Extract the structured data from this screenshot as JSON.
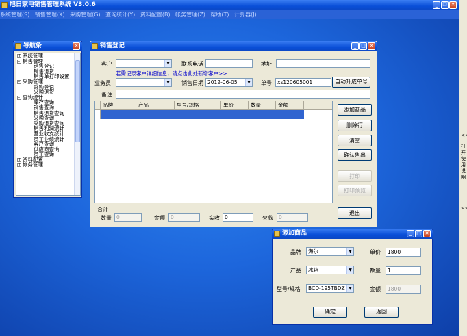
{
  "app": {
    "title": "旭日家电销售管理系统 V3.0.6",
    "menu": [
      "系统管理(S)",
      "销售管理(X)",
      "采购管理(G)",
      "查询统计(Y)",
      "资料配置(B)",
      "帐务管理(Z)",
      "帮助(T)",
      "计算器(J)"
    ],
    "sidebar_text": "打开使用说明",
    "sidebar_chevron": "<<"
  },
  "navigator": {
    "title": "导航条",
    "tree": [
      {
        "label": "系统管理",
        "level": 0,
        "expander": "+"
      },
      {
        "label": "销售管理",
        "level": 0,
        "expander": "-"
      },
      {
        "label": "销售登记",
        "level": 2
      },
      {
        "label": "销售退货",
        "level": 2
      },
      {
        "label": "销售单打印设置",
        "level": 2
      },
      {
        "label": "采购管理",
        "level": 0,
        "expander": "-"
      },
      {
        "label": "采购登记",
        "level": 2
      },
      {
        "label": "采购退货",
        "level": 2
      },
      {
        "label": "查询统计",
        "level": 0,
        "expander": "-"
      },
      {
        "label": "库存查询",
        "level": 2
      },
      {
        "label": "销售查询",
        "level": 2
      },
      {
        "label": "销售退货查询",
        "level": 2
      },
      {
        "label": "采购查询",
        "level": 2
      },
      {
        "label": "采购退货查询",
        "level": 2
      },
      {
        "label": "销售利润统计",
        "level": 2
      },
      {
        "label": "营业收支统计",
        "level": 2
      },
      {
        "label": "员工业绩统计",
        "level": 2
      },
      {
        "label": "客户查询",
        "level": 2
      },
      {
        "label": "供应商查询",
        "level": 2
      },
      {
        "label": "员工查询",
        "level": 2
      },
      {
        "label": "资料配置",
        "level": 0,
        "expander": "+"
      },
      {
        "label": "帐务管理",
        "level": 0,
        "expander": "+"
      }
    ]
  },
  "sales": {
    "title": "销售登记",
    "customer_label": "客户",
    "phone_label": "联系电话",
    "address_label": "地址",
    "hint_link": "若需记录客户详细信息，请点击此处新增客户>>",
    "salesperson_label": "业务员",
    "date_label": "销售日期",
    "date_value": "2012-06-05",
    "no_label": "单号",
    "no_value": "xs120605001",
    "auto_no_button": "自动升成单号",
    "remark_label": "备注",
    "columns": [
      "品牌",
      "产品",
      "型号/规格",
      "单价",
      "数量",
      "金额"
    ],
    "buttons": {
      "add": "添加商品",
      "delete": "删除行",
      "clear": "清空",
      "confirm": "确认售出",
      "print": "打印",
      "print_preview": "打印预览",
      "exit": "退出"
    },
    "totals": {
      "heading": "合计",
      "qty_label": "数量",
      "qty_value": "0",
      "amount_label": "金额",
      "amount_value": "0",
      "paid_label": "实收",
      "paid_value": "0",
      "owed_label": "欠款",
      "owed_value": "0"
    }
  },
  "add_product": {
    "title": "添加商品",
    "brand_label": "品牌",
    "brand_value": "海尔",
    "product_label": "产品",
    "product_value": "冰箱",
    "model_label": "型号/规格",
    "model_value": "BCD-195TBDZ",
    "price_label": "单价",
    "price_value": "1800",
    "qty_label": "数量",
    "qty_value": "1",
    "amount_label": "金额",
    "amount_value": "1800",
    "ok_button": "确定",
    "back_button": "返回"
  }
}
